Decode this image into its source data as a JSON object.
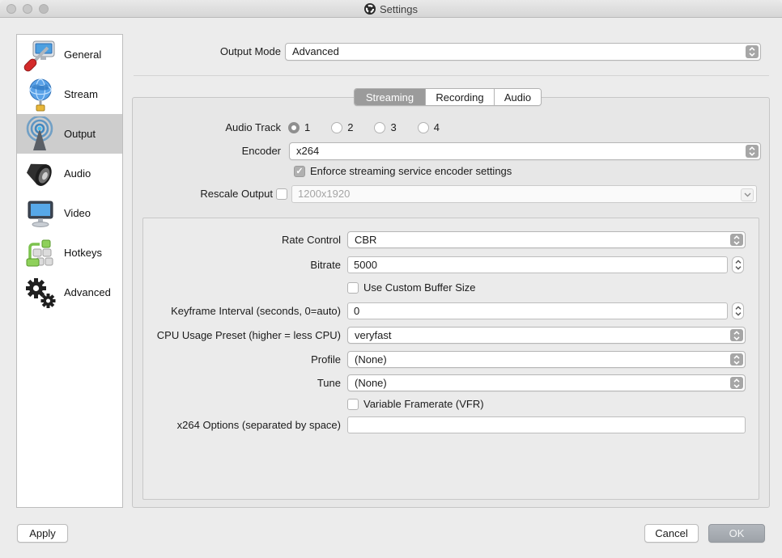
{
  "window": {
    "title": "Settings"
  },
  "sidebar": {
    "selected_index": 2,
    "items": [
      {
        "label": "General",
        "icon": "general-icon"
      },
      {
        "label": "Stream",
        "icon": "stream-icon"
      },
      {
        "label": "Output",
        "icon": "output-icon"
      },
      {
        "label": "Audio",
        "icon": "audio-icon"
      },
      {
        "label": "Video",
        "icon": "video-icon"
      },
      {
        "label": "Hotkeys",
        "icon": "hotkeys-icon"
      },
      {
        "label": "Advanced",
        "icon": "advanced-icon"
      }
    ]
  },
  "output_mode": {
    "label": "Output Mode",
    "value": "Advanced"
  },
  "tabs": [
    {
      "label": "Streaming",
      "selected": true
    },
    {
      "label": "Recording",
      "selected": false
    },
    {
      "label": "Audio",
      "selected": false
    }
  ],
  "streaming": {
    "audio_track": {
      "label": "Audio Track",
      "options": [
        "1",
        "2",
        "3",
        "4"
      ],
      "selected": "1"
    },
    "encoder": {
      "label": "Encoder",
      "value": "x264"
    },
    "enforce": {
      "label": "Enforce streaming service encoder settings",
      "checked": true,
      "checkmark": "✓"
    },
    "rescale": {
      "label": "Rescale Output",
      "checked": false,
      "value": "1200x1920",
      "disabled": true
    },
    "group": {
      "rate_control": {
        "label": "Rate Control",
        "value": "CBR"
      },
      "bitrate": {
        "label": "Bitrate",
        "value": "5000"
      },
      "custom_buffer": {
        "label": "Use Custom Buffer Size",
        "checked": false
      },
      "keyframe": {
        "label": "Keyframe Interval (seconds, 0=auto)",
        "value": "0"
      },
      "cpu_preset": {
        "label": "CPU Usage Preset (higher = less CPU)",
        "value": "veryfast"
      },
      "profile": {
        "label": "Profile",
        "value": "(None)"
      },
      "tune": {
        "label": "Tune",
        "value": "(None)"
      },
      "vfr": {
        "label": "Variable Framerate (VFR)",
        "checked": false
      },
      "x264_options": {
        "label": "x264 Options (separated by space)",
        "value": ""
      }
    }
  },
  "footer": {
    "apply": "Apply",
    "cancel": "Cancel",
    "ok": "OK"
  },
  "colors": {
    "window_bg": "#ececec",
    "pane_bg": "#e7e7e7",
    "group_bg": "#ebebeb",
    "selected_tab": "#9b9b9b",
    "sidebar_selected": "#cdcdcd",
    "ok_button": "#a6abb1",
    "stepper": "#a6a6a6"
  }
}
